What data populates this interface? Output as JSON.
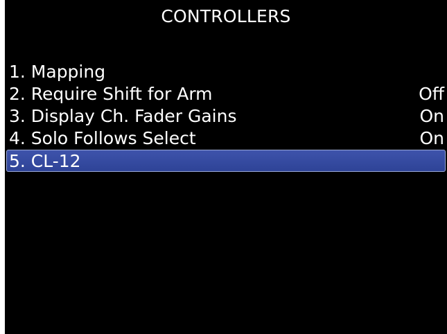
{
  "title": "CONTROLLERS",
  "menu": {
    "items": [
      {
        "label": "1. Mapping",
        "value": ""
      },
      {
        "label": "2. Require Shift for Arm",
        "value": "Off"
      },
      {
        "label": "3. Display Ch. Fader Gains",
        "value": "On"
      },
      {
        "label": "4. Solo Follows Select",
        "value": "On"
      },
      {
        "label": "5. CL-12",
        "value": ""
      }
    ],
    "selected_index": 4
  },
  "colors": {
    "background": "#000000",
    "text": "#ffffff",
    "highlight": "#3549a0",
    "highlight_border": "#9aa8d6"
  }
}
